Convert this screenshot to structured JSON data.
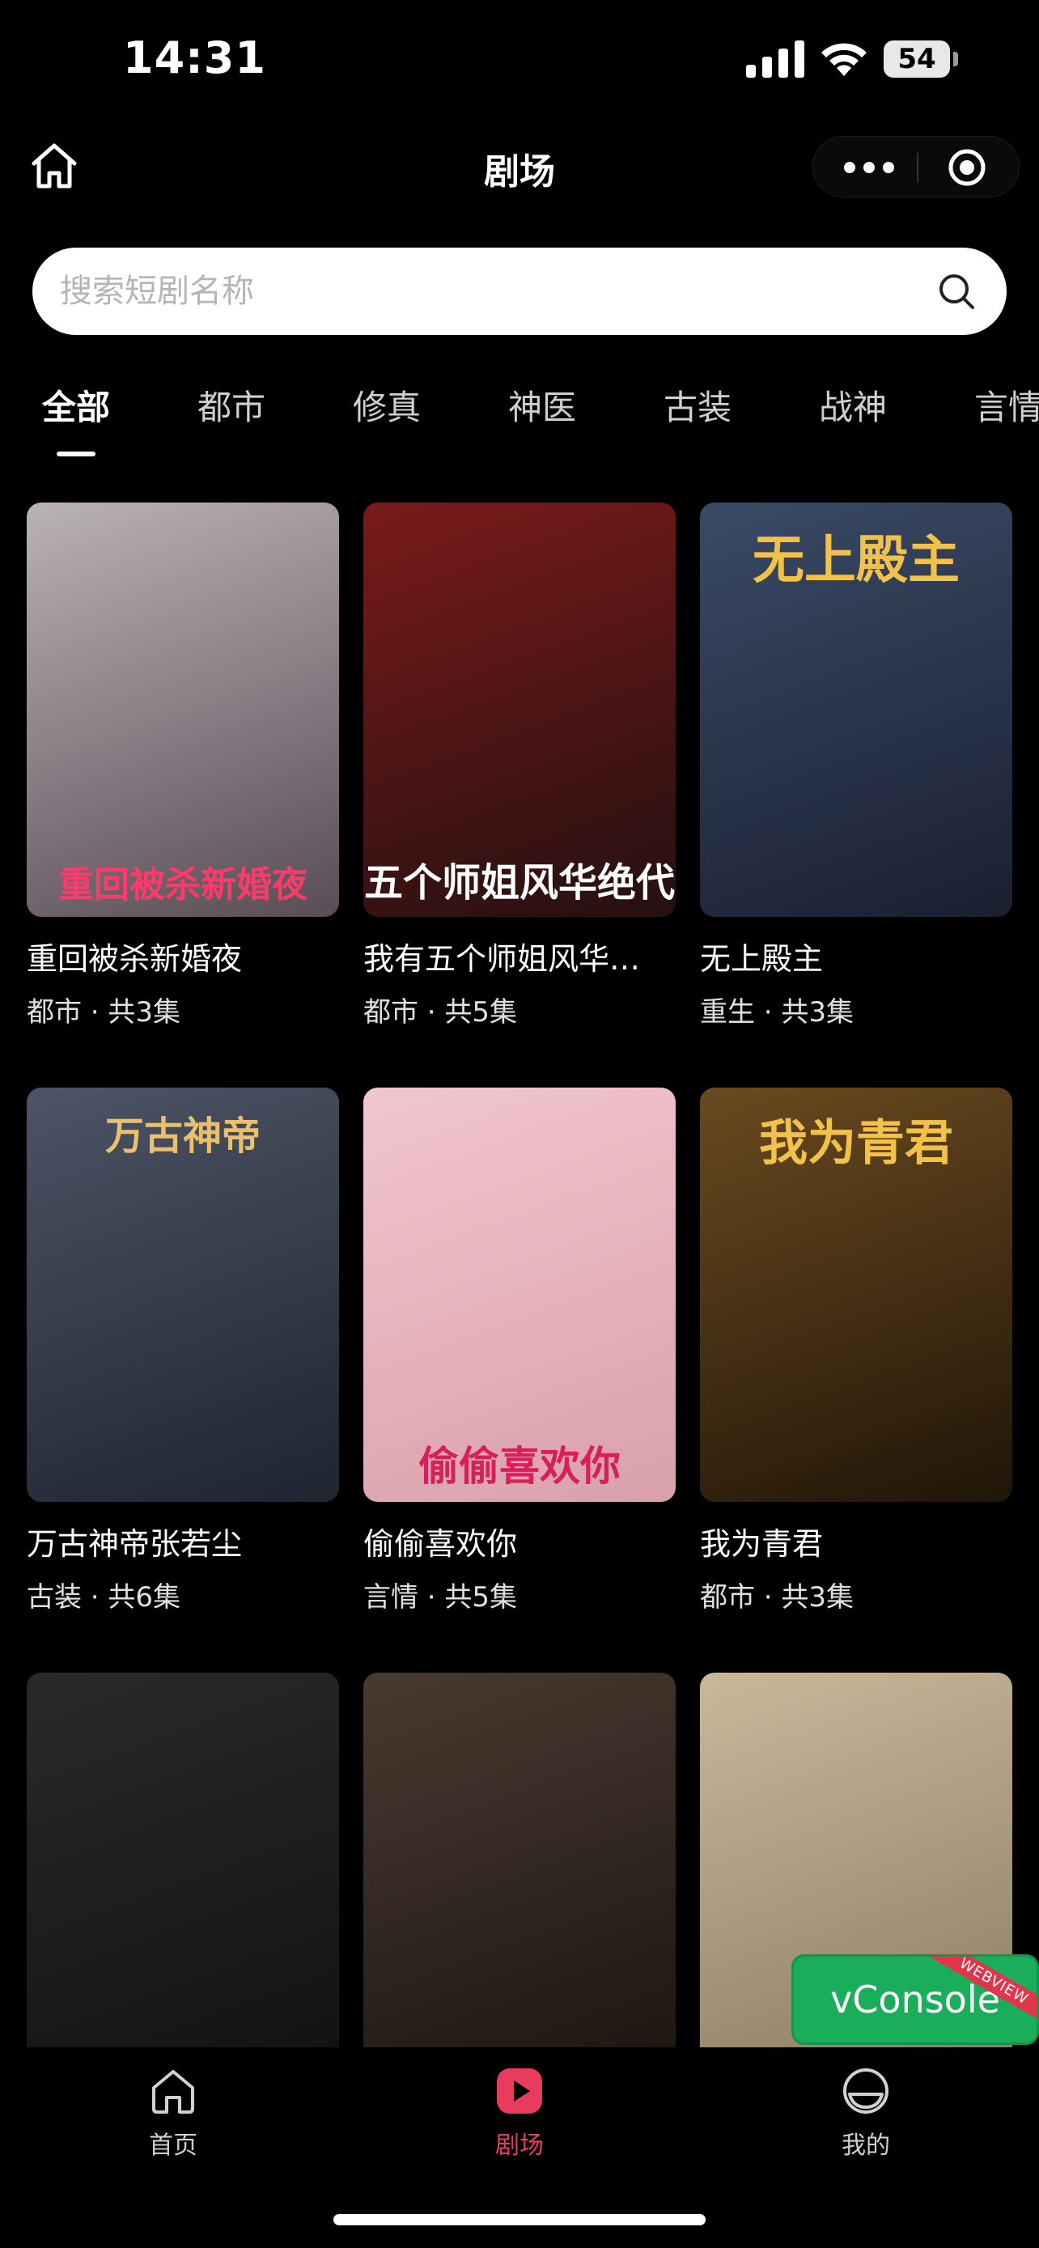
{
  "status_bar": {
    "time": "14:31",
    "battery": "54"
  },
  "nav": {
    "title": "剧场"
  },
  "search": {
    "placeholder": "搜索短剧名称"
  },
  "tabs": [
    {
      "label": "全部",
      "active": true
    },
    {
      "label": "都市"
    },
    {
      "label": "修真"
    },
    {
      "label": "神医"
    },
    {
      "label": "古装"
    },
    {
      "label": "战神"
    },
    {
      "label": "言情"
    }
  ],
  "dramas": [
    {
      "title": "重回被杀新婚夜",
      "meta": "都市 · 共3集",
      "poster_text": "重回被杀新婚夜",
      "colors": [
        "#b9b2b6",
        "#5a4d55"
      ]
    },
    {
      "title": "我有五个师姐风华…",
      "meta": "都市 · 共5集",
      "poster_text": "五个师姐风华绝代",
      "colors": [
        "#7a1a1a",
        "#241010"
      ]
    },
    {
      "title": "无上殿主",
      "meta": "重生 · 共3集",
      "poster_text": "无上殿主",
      "colors": [
        "#3a4a66",
        "#1a2030"
      ]
    },
    {
      "title": "万古神帝张若尘",
      "meta": "古装 · 共6集",
      "poster_text": "万古神帝",
      "colors": [
        "#4c5566",
        "#1e2430"
      ]
    },
    {
      "title": "偷偷喜欢你",
      "meta": "言情 · 共5集",
      "poster_text": "偷偷喜欢你",
      "colors": [
        "#f2c6cf",
        "#d9a0aa"
      ]
    },
    {
      "title": "我为青君",
      "meta": "都市 · 共3集",
      "poster_text": "我为青君",
      "colors": [
        "#6a4a20",
        "#201508"
      ]
    },
    {
      "title": "",
      "meta": "",
      "poster_text": "",
      "colors": [
        "#2c2a28",
        "#121110"
      ]
    },
    {
      "title": "",
      "meta": "",
      "poster_text": "",
      "colors": [
        "#4a3a30",
        "#1a1410"
      ]
    },
    {
      "title": "",
      "meta": "",
      "poster_text": "",
      "colors": [
        "#c9b89a",
        "#8a7a60"
      ]
    }
  ],
  "vconsole": {
    "label": "vConsole",
    "ribbon": "WEBVIEW"
  },
  "tabbar": {
    "items": [
      {
        "label": "首页",
        "icon": "home-icon"
      },
      {
        "label": "剧场",
        "icon": "play-icon",
        "active": true
      },
      {
        "label": "我的",
        "icon": "profile-icon"
      }
    ],
    "active_color": "#e83c5c"
  }
}
